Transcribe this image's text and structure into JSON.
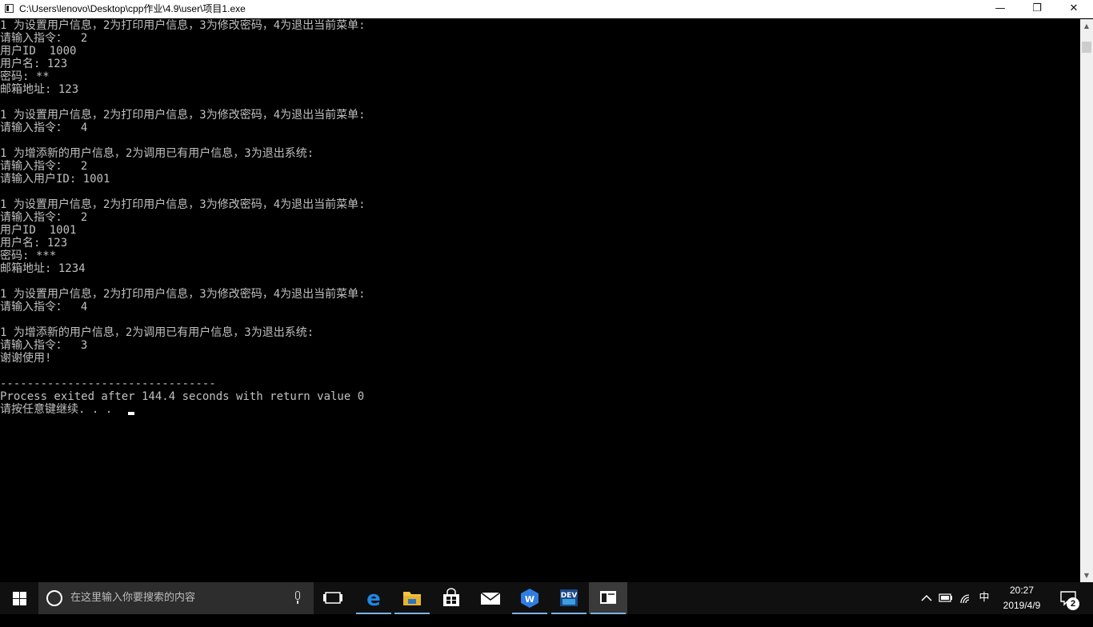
{
  "window": {
    "title": "C:\\Users\\lenovo\\Desktop\\cpp作业\\4.9\\user\\项目1.exe",
    "minimize_glyph": "—",
    "maximize_glyph": "❐",
    "close_glyph": "✕"
  },
  "console": {
    "lines": [
      "1 为设置用户信息，2为打印用户信息，3为修改密码，4为退出当前菜单:",
      "请输入指令：  2",
      "用户ID  1000",
      "用户名: 123",
      "密码: **",
      "邮箱地址: 123",
      "",
      "1 为设置用户信息，2为打印用户信息，3为修改密码，4为退出当前菜单:",
      "请输入指令：  4",
      "",
      "1 为增添新的用户信息，2为调用已有用户信息，3为退出系统:",
      "请输入指令：  2",
      "请输入用户ID: 1001",
      "",
      "1 为设置用户信息，2为打印用户信息，3为修改密码，4为退出当前菜单:",
      "请输入指令：  2",
      "用户ID  1001",
      "用户名: 123",
      "密码: ***",
      "邮箱地址: 1234",
      "",
      "1 为设置用户信息，2为打印用户信息，3为修改密码，4为退出当前菜单:",
      "请输入指令：  4",
      "",
      "1 为增添新的用户信息，2为调用已有用户信息，3为退出系统:",
      "请输入指令：  3",
      "谢谢使用!",
      "",
      "--------------------------------",
      "Process exited after 144.4 seconds with return value 0",
      "请按任意键继续. . . "
    ],
    "text_color": "#c0c0c0",
    "background_color": "#000000"
  },
  "taskbar": {
    "search_placeholder": "在这里输入你要搜索的内容",
    "apps": [
      {
        "name": "task-view",
        "icon": "task-view-icon"
      },
      {
        "name": "edge",
        "icon": "edge-icon"
      },
      {
        "name": "file-explorer",
        "icon": "folder-icon"
      },
      {
        "name": "store",
        "icon": "store-icon"
      },
      {
        "name": "mail",
        "icon": "mail-icon"
      },
      {
        "name": "wps",
        "icon": "wps-icon"
      },
      {
        "name": "dev-cpp",
        "icon": "dev-cpp-icon",
        "label": "DEV"
      },
      {
        "name": "console",
        "icon": "console-icon",
        "active": true
      }
    ],
    "tray": {
      "ime": "中",
      "time": "20:27",
      "date": "2019/4/9",
      "notification_count": "2"
    }
  }
}
